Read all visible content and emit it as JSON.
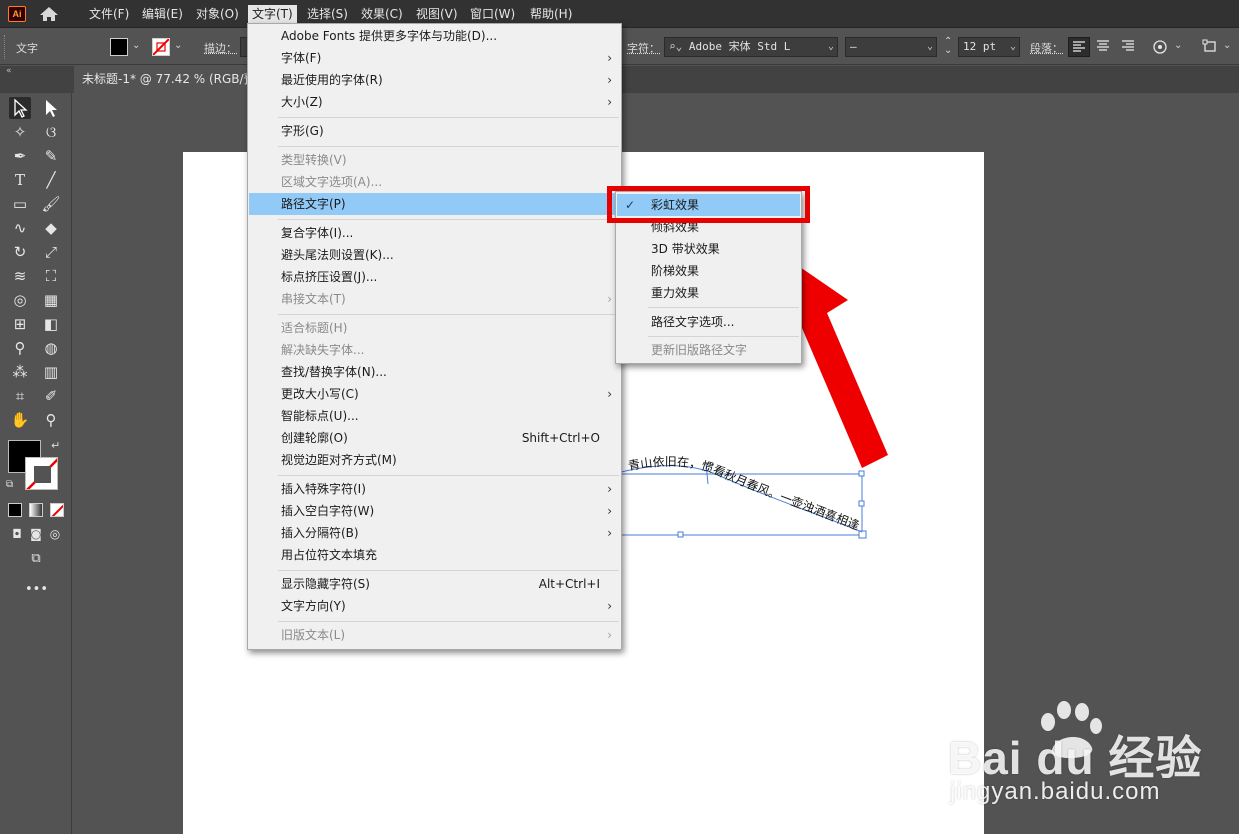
{
  "app": {
    "logo_text": "Ai"
  },
  "menubar": {
    "items": [
      "文件(F)",
      "编辑(E)",
      "对象(O)",
      "文字(T)",
      "选择(S)",
      "效果(C)",
      "视图(V)",
      "窗口(W)",
      "帮助(H)"
    ]
  },
  "control": {
    "mode_label": "文字",
    "stroke_label": "描边：",
    "char_label": "字符：",
    "font_name": "Adobe 宋体 Std L",
    "font_style": "–",
    "font_size": "12 pt",
    "para_label": "段落："
  },
  "document": {
    "tab_title": "未标题-1* @ 77.42 % (RGB/预览)"
  },
  "text_menu": {
    "items": [
      {
        "label": "Adobe Fonts 提供更多字体与功能(D)...",
        "shortcut": "",
        "submenu": false,
        "disabled": false
      },
      {
        "label": "字体(F)",
        "shortcut": "",
        "submenu": true,
        "disabled": false
      },
      {
        "label": "最近使用的字体(R)",
        "shortcut": "",
        "submenu": true,
        "disabled": false
      },
      {
        "label": "大小(Z)",
        "shortcut": "",
        "submenu": true,
        "disabled": false
      },
      {
        "label": "字形(G)",
        "shortcut": "",
        "submenu": false,
        "disabled": false
      },
      {
        "label": "类型转换(V)",
        "shortcut": "",
        "submenu": false,
        "disabled": true
      },
      {
        "label": "区域文字选项(A)...",
        "shortcut": "",
        "submenu": false,
        "disabled": true
      },
      {
        "label": "路径文字(P)",
        "shortcut": "",
        "submenu": true,
        "disabled": false,
        "highlighted": true
      },
      {
        "label": "复合字体(I)...",
        "shortcut": "",
        "submenu": false,
        "disabled": false
      },
      {
        "label": "避头尾法则设置(K)...",
        "shortcut": "",
        "submenu": false,
        "disabled": false
      },
      {
        "label": "标点挤压设置(J)...",
        "shortcut": "",
        "submenu": false,
        "disabled": false
      },
      {
        "label": "串接文本(T)",
        "shortcut": "",
        "submenu": true,
        "disabled": true
      },
      {
        "label": "适合标题(H)",
        "shortcut": "",
        "submenu": false,
        "disabled": true
      },
      {
        "label": "解决缺失字体...",
        "shortcut": "",
        "submenu": false,
        "disabled": true
      },
      {
        "label": "查找/替换字体(N)...",
        "shortcut": "",
        "submenu": false,
        "disabled": false
      },
      {
        "label": "更改大小写(C)",
        "shortcut": "",
        "submenu": true,
        "disabled": false
      },
      {
        "label": "智能标点(U)...",
        "shortcut": "",
        "submenu": false,
        "disabled": false
      },
      {
        "label": "创建轮廓(O)",
        "shortcut": "Shift+Ctrl+O",
        "submenu": false,
        "disabled": false
      },
      {
        "label": "视觉边距对齐方式(M)",
        "shortcut": "",
        "submenu": false,
        "disabled": false
      },
      {
        "label": "插入特殊字符(I)",
        "shortcut": "",
        "submenu": true,
        "disabled": false
      },
      {
        "label": "插入空白字符(W)",
        "shortcut": "",
        "submenu": true,
        "disabled": false
      },
      {
        "label": "插入分隔符(B)",
        "shortcut": "",
        "submenu": true,
        "disabled": false
      },
      {
        "label": "用占位符文本填充",
        "shortcut": "",
        "submenu": false,
        "disabled": false
      },
      {
        "label": "显示隐藏字符(S)",
        "shortcut": "Alt+Ctrl+I",
        "submenu": false,
        "disabled": false
      },
      {
        "label": "文字方向(Y)",
        "shortcut": "",
        "submenu": true,
        "disabled": false
      },
      {
        "label": "旧版文本(L)",
        "shortcut": "",
        "submenu": true,
        "disabled": true
      }
    ]
  },
  "path_submenu": {
    "items": [
      {
        "label": "彩虹效果",
        "checked": true,
        "disabled": false
      },
      {
        "label": "倾斜效果",
        "checked": false,
        "disabled": false
      },
      {
        "label": "3D 带状效果",
        "checked": false,
        "disabled": false
      },
      {
        "label": "阶梯效果",
        "checked": false,
        "disabled": false
      },
      {
        "label": "重力效果",
        "checked": false,
        "disabled": false
      },
      {
        "label": "路径文字选项...",
        "checked": false,
        "disabled": false
      },
      {
        "label": "更新旧版路径文字",
        "checked": false,
        "disabled": true
      }
    ]
  },
  "artwork": {
    "path_text": "青山依旧在，惯看秋月春风。一壶浊酒喜相逢"
  },
  "colors": {
    "menu_highlight": "#91c9f7",
    "annotation_red": "#e60000",
    "selection_blue": "#4a7ed8"
  },
  "watermark": {
    "brand": "Bai du 经验",
    "url": "jingyan.baidu.com"
  }
}
